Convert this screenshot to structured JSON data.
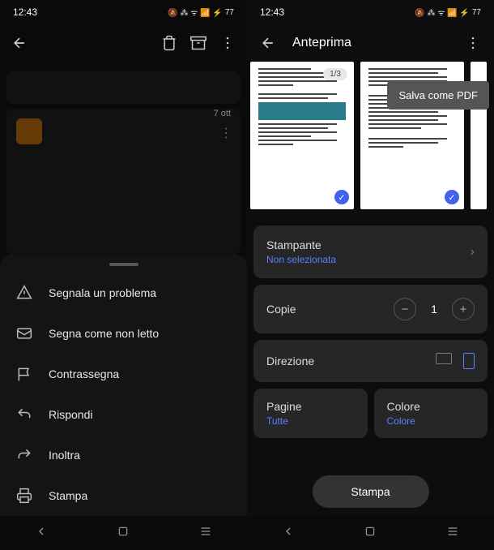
{
  "status": {
    "time": "12:43",
    "battery": "77"
  },
  "left": {
    "card_date": "7 ott",
    "menu": [
      {
        "label": "Segnala un problema"
      },
      {
        "label": "Segna come non letto"
      },
      {
        "label": "Contrassegna"
      },
      {
        "label": "Rispondi"
      },
      {
        "label": "Inoltra"
      },
      {
        "label": "Stampa"
      }
    ]
  },
  "right": {
    "header_title": "Anteprima",
    "tooltip": "Salva come PDF",
    "page_indicator": "1/3",
    "settings": {
      "printer": {
        "label": "Stampante",
        "value": "Non selezionata"
      },
      "copies": {
        "label": "Copie",
        "value": "1"
      },
      "direction": {
        "label": "Direzione"
      },
      "pages": {
        "label": "Pagine",
        "value": "Tutte"
      },
      "color": {
        "label": "Colore",
        "value": "Colore"
      }
    },
    "print_button": "Stampa"
  }
}
